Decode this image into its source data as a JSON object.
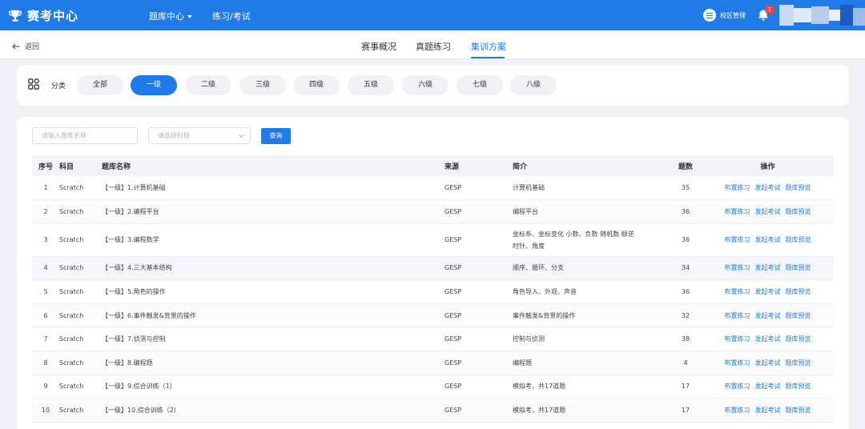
{
  "app": {
    "title": "赛考中心"
  },
  "nav": {
    "question_bank": "题库中心",
    "practice": "练习/考试"
  },
  "header": {
    "campus_manage": "校区管理",
    "notification_count": "1"
  },
  "subnav": {
    "back": "返回",
    "tabs": [
      {
        "label": "赛事概况",
        "active": false
      },
      {
        "label": "真题练习",
        "active": false
      },
      {
        "label": "集训方案",
        "active": true
      }
    ]
  },
  "category": {
    "label": "分类",
    "pills": [
      {
        "label": "全部",
        "active": false
      },
      {
        "label": "一级",
        "active": true
      },
      {
        "label": "二级",
        "active": false
      },
      {
        "label": "三级",
        "active": false
      },
      {
        "label": "四级",
        "active": false
      },
      {
        "label": "五级",
        "active": false
      },
      {
        "label": "六级",
        "active": false
      },
      {
        "label": "七级",
        "active": false
      },
      {
        "label": "八级",
        "active": false
      }
    ]
  },
  "filters": {
    "search_placeholder": "请输入题库名称",
    "subject_placeholder": "请选择科目",
    "query_label": "查询"
  },
  "table": {
    "columns": [
      "序号",
      "科目",
      "题库名称",
      "来源",
      "简介",
      "题数",
      "操作"
    ],
    "actions": [
      "布置练习",
      "发起考试",
      "题库预览"
    ],
    "rows": [
      {
        "no": "1",
        "subject": "Scratch",
        "name": "【一级】1.计算机基础",
        "source": "GESP",
        "intro": "计算机基础",
        "count": "35"
      },
      {
        "no": "2",
        "subject": "Scratch",
        "name": "【一级】2.编程平台",
        "source": "GESP",
        "intro": "编程平台",
        "count": "36"
      },
      {
        "no": "3",
        "subject": "Scratch",
        "name": "【一级】3.编程数学",
        "source": "GESP",
        "intro": "坐标系、坐标变化 小数、负数 随机数 顺逆时针、角度",
        "count": "36"
      },
      {
        "no": "4",
        "subject": "Scratch",
        "name": "【一级】4.三大基本结构",
        "source": "GESP",
        "intro": "顺序、循环、分支",
        "count": "34"
      },
      {
        "no": "5",
        "subject": "Scratch",
        "name": "【一级】5.角色的操作",
        "source": "GESP",
        "intro": "角色导入、外观、声音",
        "count": "36"
      },
      {
        "no": "6",
        "subject": "Scratch",
        "name": "【一级】6.事件触发&背景的操作",
        "source": "GESP",
        "intro": "事件触发&背景的操作",
        "count": "32"
      },
      {
        "no": "7",
        "subject": "Scratch",
        "name": "【一级】7.侦测与控制",
        "source": "GESP",
        "intro": "控制与侦测",
        "count": "38"
      },
      {
        "no": "8",
        "subject": "Scratch",
        "name": "【一级】8.编程题",
        "source": "GESP",
        "intro": "编程题",
        "count": "4"
      },
      {
        "no": "9",
        "subject": "Scratch",
        "name": "【一级】9.综合训练（1）",
        "source": "GESP",
        "intro": "模拟考，共17道题",
        "count": "17"
      },
      {
        "no": "10",
        "subject": "Scratch",
        "name": "【一级】10.综合训练（2）",
        "source": "GESP",
        "intro": "模拟考，共17道题",
        "count": "17"
      }
    ]
  }
}
